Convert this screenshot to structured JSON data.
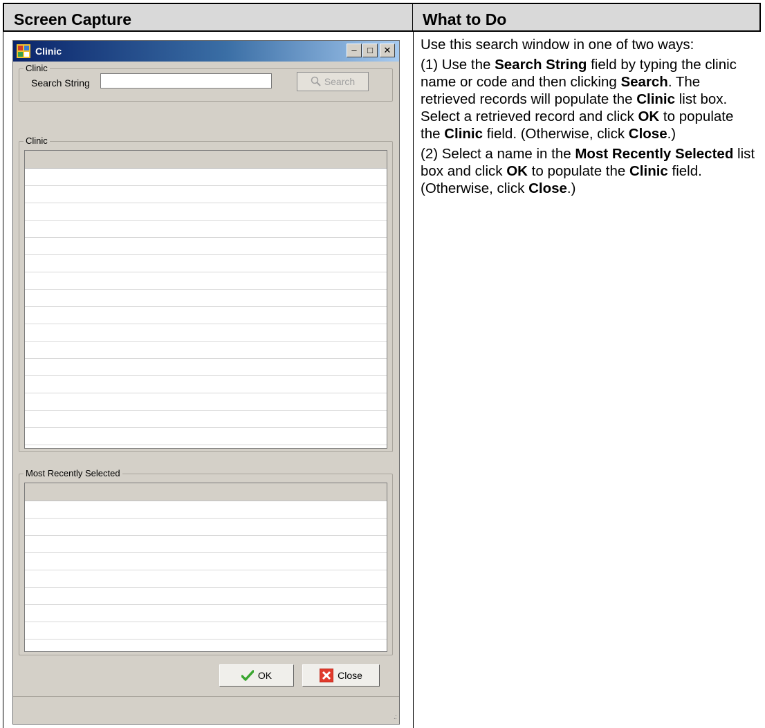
{
  "table": {
    "header_left": "Screen Capture",
    "header_right": "What to Do"
  },
  "window": {
    "title": "Clinic",
    "search_group_label": "Clinic",
    "search_string_label": "Search String",
    "search_input_value": "",
    "search_button_label": "Search",
    "clinic_list_label": "Clinic",
    "recent_list_label": "Most Recently Selected",
    "ok_label": "OK",
    "close_label": "Close",
    "icons": {
      "app": "clinic-app-icon",
      "minimize": "minimize-icon",
      "maximize": "maximize-icon",
      "close": "close-icon",
      "search": "magnifier-icon",
      "ok": "checkmark-icon",
      "close_btn": "red-x-icon"
    }
  },
  "instructions": {
    "intro": "Use this search window in one of two ways:",
    "step1": {
      "t1": "(1) Use the ",
      "b1": "Search String",
      "t2": " field by typing the clinic name or code and then clicking ",
      "b2": "Search",
      "t3": ". The retrieved records will populate the ",
      "b3": "Clinic",
      "t4": " list box. Select a retrieved record and click ",
      "b4": "OK",
      "t5": " to populate the ",
      "b5": "Clinic",
      "t6": " field. (Otherwise, click ",
      "b6": "Close",
      "t7": ".)"
    },
    "step2": {
      "t1": "(2) Select a name in the ",
      "b1": "Most Recently Selected",
      "t2": " list box and click ",
      "b2": "OK",
      "t3": " to populate the ",
      "b3": "Clinic",
      "t4": " field. (Otherwise, click ",
      "b4": "Close",
      "t5": ".)"
    }
  }
}
